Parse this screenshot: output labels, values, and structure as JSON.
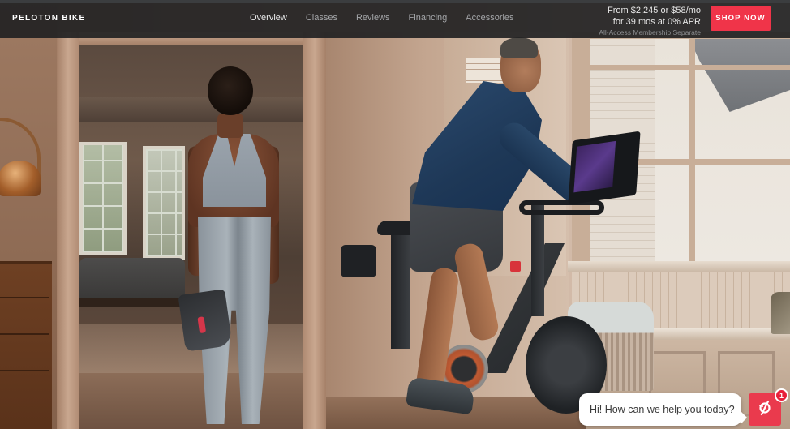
{
  "nav": {
    "brand": "PELOTON BIKE",
    "links": [
      {
        "label": "Overview",
        "active": true
      },
      {
        "label": "Classes",
        "active": false
      },
      {
        "label": "Reviews",
        "active": false
      },
      {
        "label": "Financing",
        "active": false
      },
      {
        "label": "Accessories",
        "active": false
      }
    ],
    "price_line_1": "From $2,245 or $58/mo",
    "price_line_2": "for 39 mos at 0% APR",
    "price_note": "All-Access Membership Separate",
    "cta_label": "SHOP NOW"
  },
  "hero": {
    "image_description": "Woman holding cycling shoes walking through doorway; man riding a Peloton bike in a sunlit room"
  },
  "chat": {
    "greeting": "Hi! How can we help you today?",
    "launcher_icon": "peloton-logo-icon",
    "unread_count": "1"
  },
  "colors": {
    "brand_red": "#f03449",
    "nav_bg": "#222223",
    "chat_launcher": "#ea3a4d"
  }
}
